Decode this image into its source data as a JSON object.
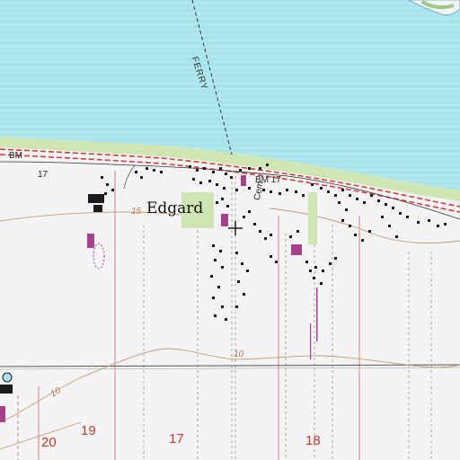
{
  "map": {
    "place_name": "Edgard",
    "labels": {
      "ferry": "FERRY",
      "cemetery": "Cem",
      "benchmark_main": "BM 17",
      "benchmark_west_bm": "BM",
      "benchmark_west_value": "17",
      "contour_15": "15",
      "contour_10_east": "10",
      "contour_10_west": "10"
    },
    "sections": [
      "20",
      "19",
      "17",
      "18"
    ],
    "colors": {
      "water": "#a9e3ec",
      "land": "#f4f4f6",
      "levee_green": "#cfe6b3",
      "road_red": "#d0403a",
      "grid_red": "#d98a8a",
      "contour_brown": "#c79a6b",
      "building": "#1a1a1a",
      "purple": "#a6418c"
    }
  }
}
